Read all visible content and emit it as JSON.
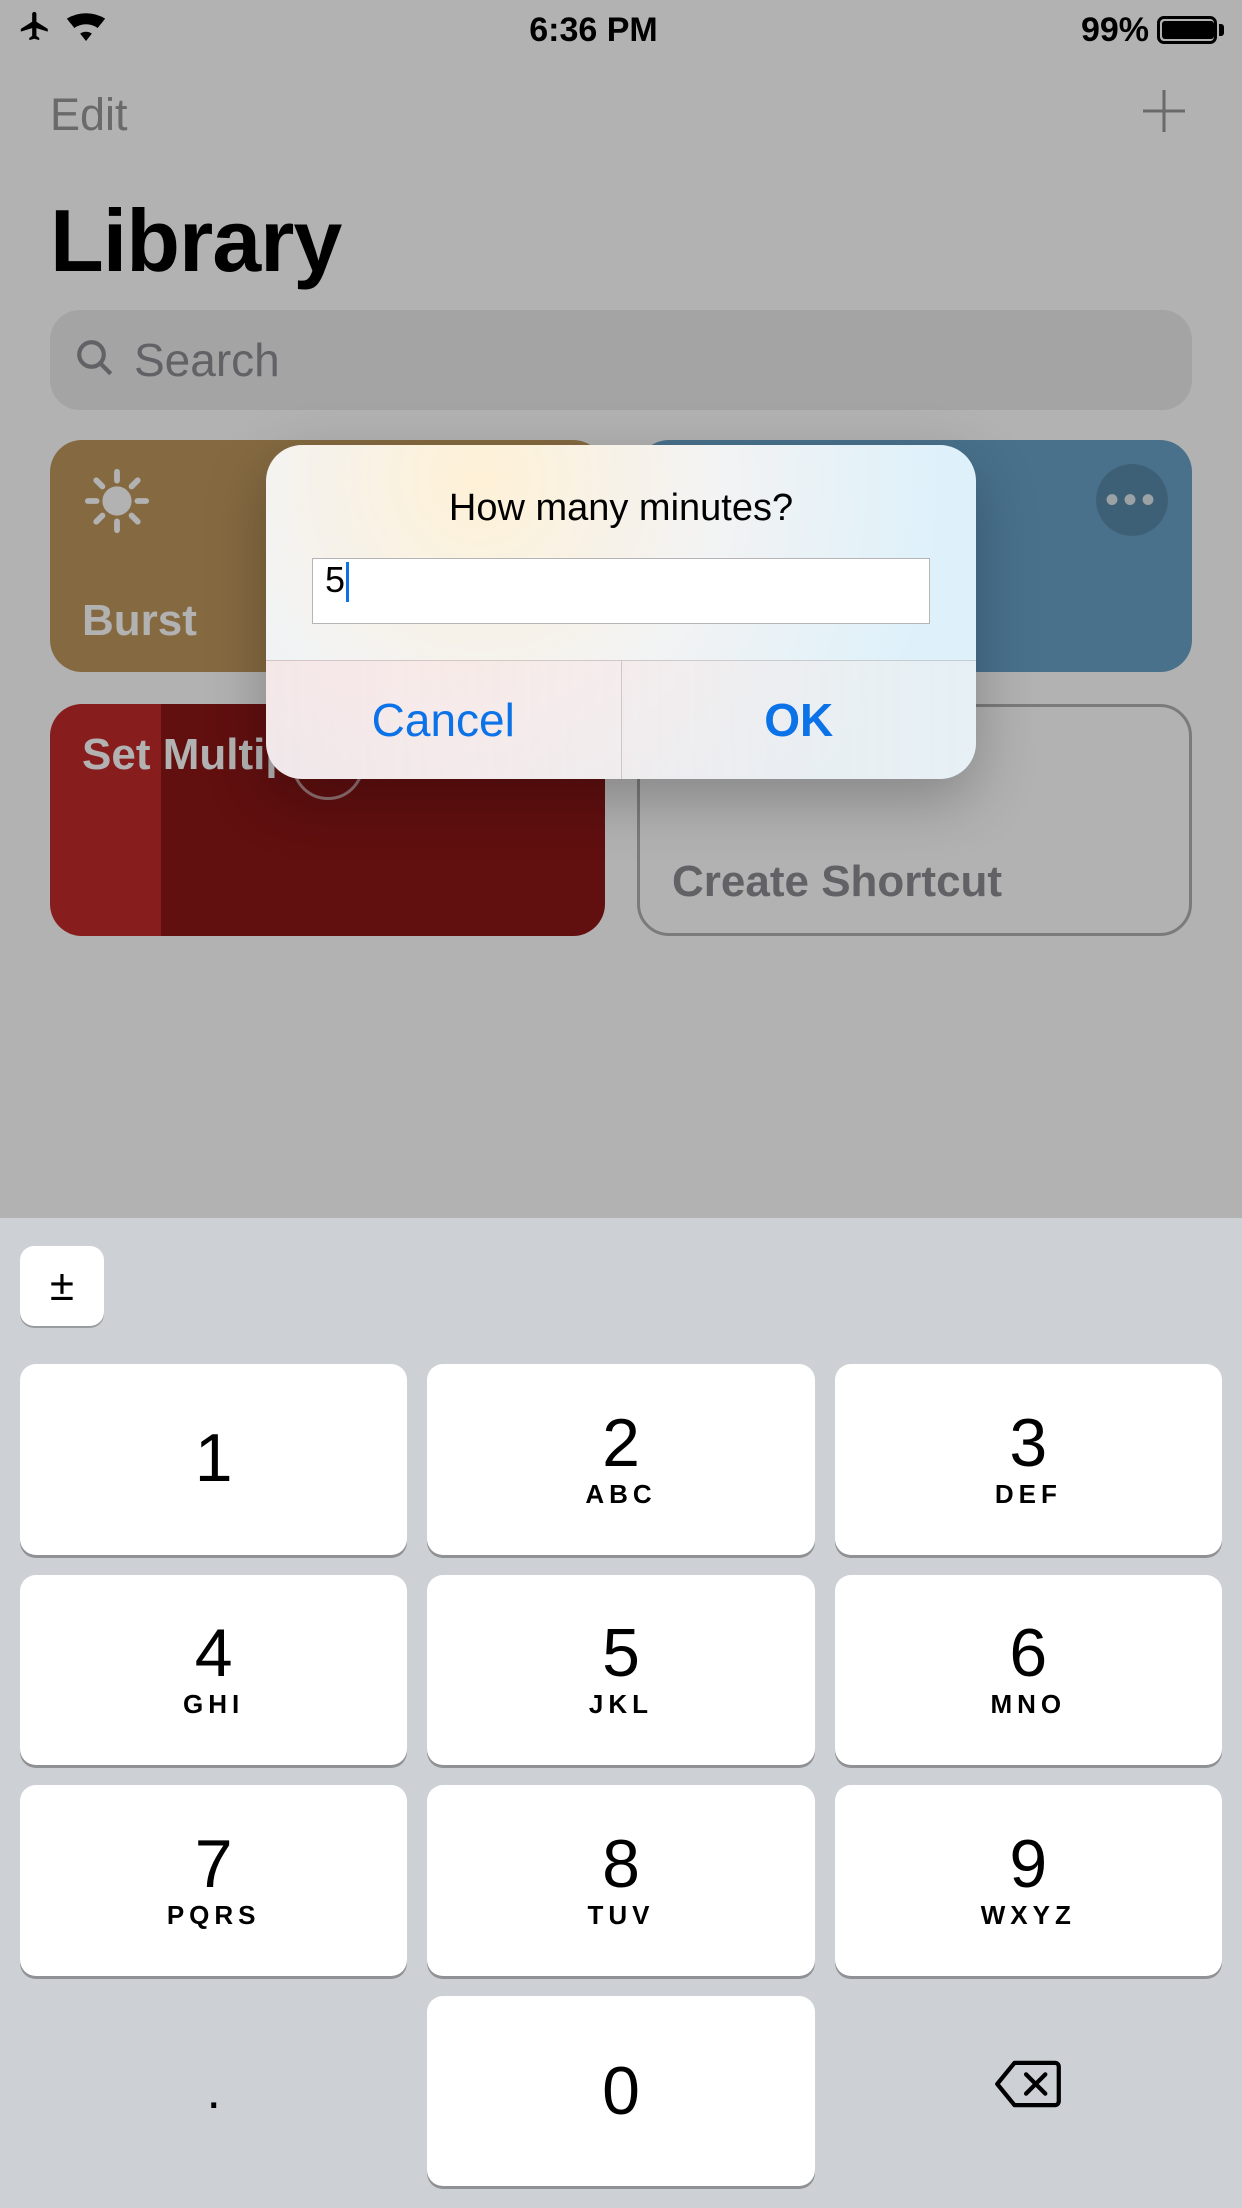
{
  "status": {
    "time": "6:36 PM",
    "battery_pct": "99%"
  },
  "navbar": {
    "edit": "Edit"
  },
  "page": {
    "title": "Library"
  },
  "search": {
    "placeholder": "Search"
  },
  "cards": {
    "burst": "Burst",
    "right_top": "",
    "set_timers": "Set Multiple Timers",
    "create": "Create Shortcut"
  },
  "modal": {
    "title": "How many minutes?",
    "value": "5",
    "cancel": "Cancel",
    "ok": "OK"
  },
  "keyboard": {
    "pm": "±",
    "keys": [
      {
        "digit": "1",
        "letters": ""
      },
      {
        "digit": "2",
        "letters": "ABC"
      },
      {
        "digit": "3",
        "letters": "DEF"
      },
      {
        "digit": "4",
        "letters": "GHI"
      },
      {
        "digit": "5",
        "letters": "JKL"
      },
      {
        "digit": "6",
        "letters": "MNO"
      },
      {
        "digit": "7",
        "letters": "PQRS"
      },
      {
        "digit": "8",
        "letters": "TUV"
      },
      {
        "digit": "9",
        "letters": "WXYZ"
      }
    ],
    "dot": ".",
    "zero": "0"
  }
}
